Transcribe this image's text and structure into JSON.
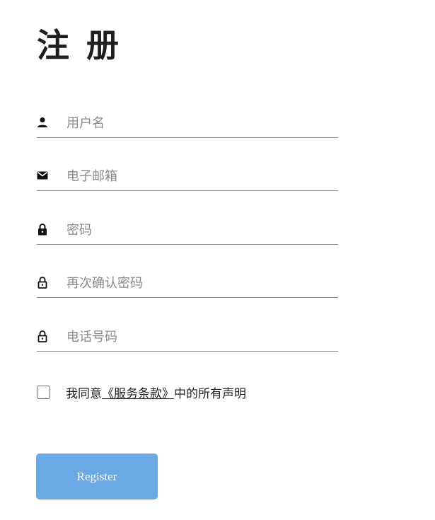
{
  "title": "注 册",
  "fields": [
    {
      "icon": "user-icon",
      "placeholder": "用户名",
      "type": "text"
    },
    {
      "icon": "mail-icon",
      "placeholder": "电子邮箱",
      "type": "email"
    },
    {
      "icon": "lock-icon",
      "placeholder": "密码",
      "type": "password"
    },
    {
      "icon": "lock-outline-icon",
      "placeholder": "再次确认密码",
      "type": "password"
    },
    {
      "icon": "lock-outline-icon",
      "placeholder": "电话号码",
      "type": "tel"
    }
  ],
  "agreement": {
    "checked": false,
    "prefix": "我同意",
    "link": "《服务条款》",
    "suffix": "中的所有声明"
  },
  "register_label": "Register",
  "colors": {
    "button": "#6aa8e6",
    "underline": "#8c8c8c",
    "title": "#1f1f1f"
  }
}
